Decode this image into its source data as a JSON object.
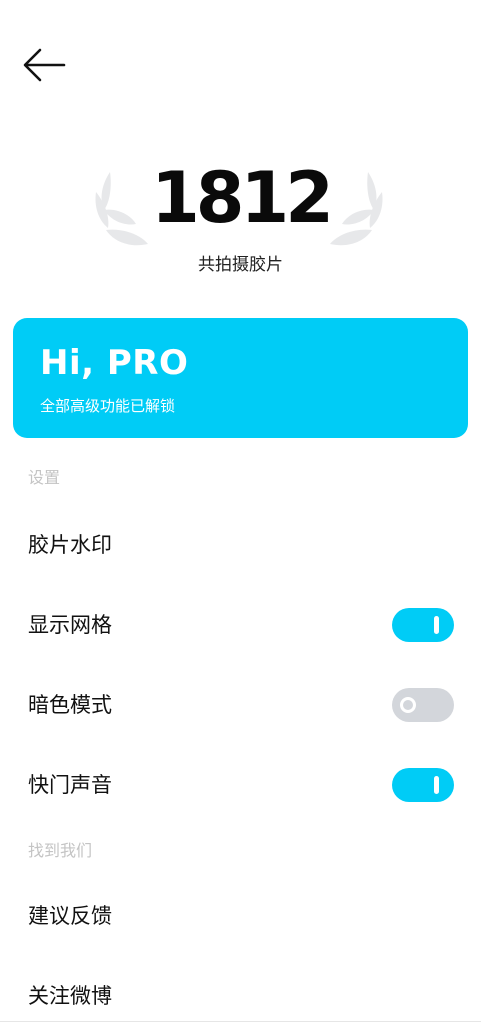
{
  "stats": {
    "count": "1812",
    "label": "共拍摄胶片"
  },
  "pro_card": {
    "title": "Hi, PRO",
    "subtitle": "全部高级功能已解锁"
  },
  "settings": {
    "header": "设置",
    "items": [
      {
        "label": "胶片水印"
      },
      {
        "label": "显示网格",
        "toggle": "on"
      },
      {
        "label": "暗色模式",
        "toggle": "off"
      },
      {
        "label": "快门声音",
        "toggle": "on"
      }
    ]
  },
  "find_us": {
    "header": "找到我们",
    "items": [
      {
        "label": "建议反馈"
      },
      {
        "label": "关注微博"
      }
    ]
  },
  "icons": {
    "back": "arrow-left-icon",
    "laurel": "laurel-wreath-icon"
  },
  "colors": {
    "accent": "#00ccf6",
    "toggle_off": "#d3d6db",
    "section_header": "#c4c4c4"
  }
}
